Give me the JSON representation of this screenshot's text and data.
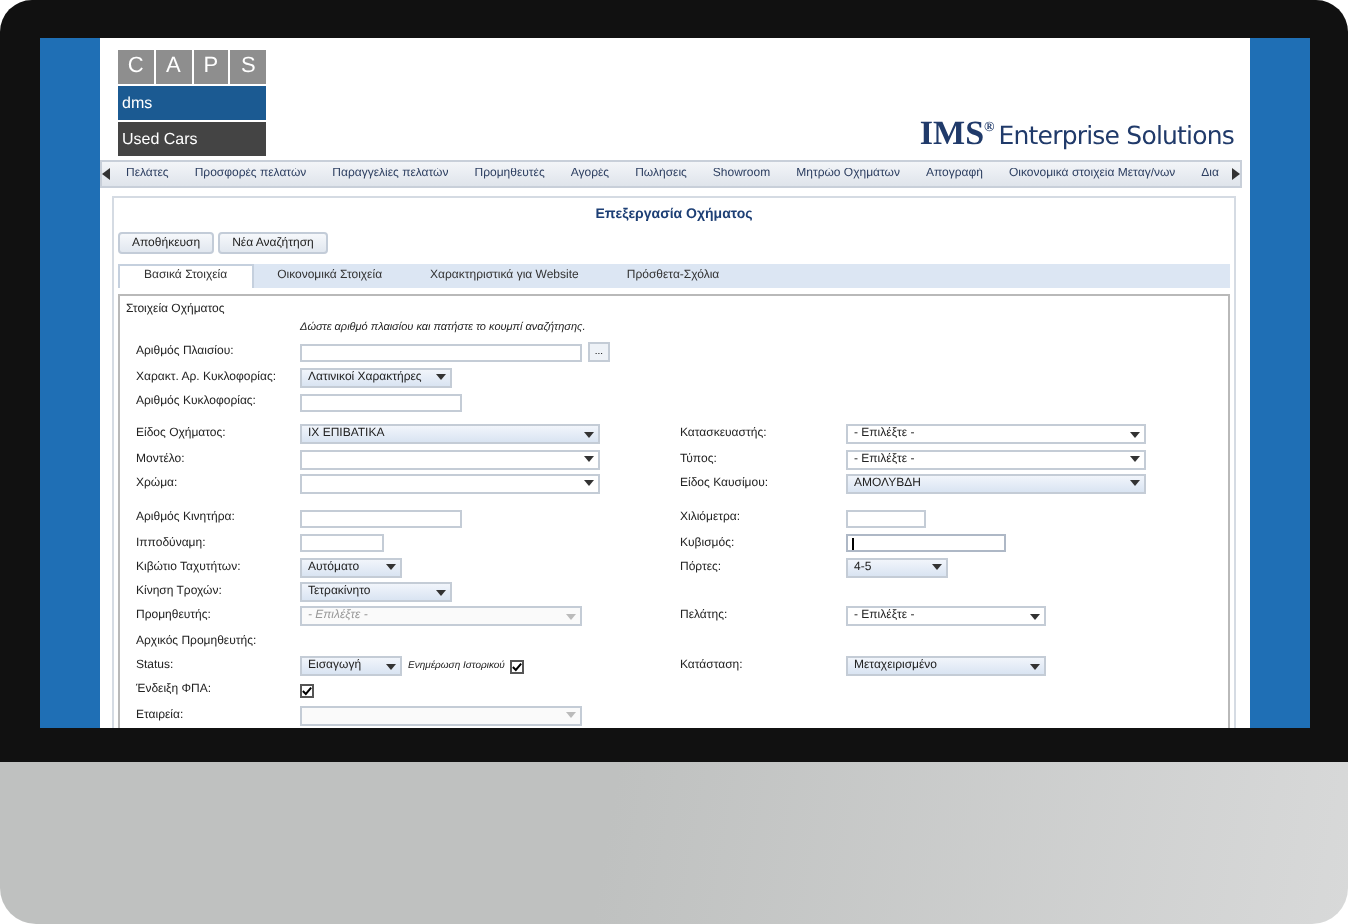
{
  "logo": {
    "letters": [
      "C",
      "A",
      "P",
      "S"
    ],
    "product": "dms",
    "module": "Used Cars"
  },
  "brand": {
    "name": "IMS$^{®}$",
    "tagline": "Enterprise Solutions"
  },
  "menu": {
    "items": [
      {
        "label": "Πελάτες"
      },
      {
        "label": "Προσφορές πελατών"
      },
      {
        "label": "Παραγγελίες πελατών"
      },
      {
        "label": "Προμηθευτές"
      },
      {
        "label": "Αγορές"
      },
      {
        "label": "Πωλήσεις"
      },
      {
        "label": "Showroom"
      },
      {
        "label": "Μητρώο Οχημάτων"
      },
      {
        "label": "Απογραφή"
      },
      {
        "label": "Οικονομικά στοιχεία Μεταγ/νων"
      },
      {
        "label": "Δια"
      }
    ]
  },
  "page": {
    "title": "Επεξεργασία Οχήματος",
    "buttons": [
      "Αποθήκευση",
      "Νέα Αναζήτηση"
    ]
  },
  "tabs": [
    {
      "label": "Βασικά Στοιχεία",
      "selected": true
    },
    {
      "label": "Οικονομικά Στοιχεία",
      "selected": false
    },
    {
      "label": "Χαρακτηριστικά για Website",
      "selected": false
    },
    {
      "label": "Πρόσθετα-Σχόλια",
      "selected": false
    }
  ],
  "fieldset": {
    "legend": "Στοιχεία Οχήματος",
    "rows": [
      {
        "hint": "Δώστε αριθμό πλαισίου και πατήστε το κουμπί αναζήτησης."
      },
      {
        "left": {
          "label": "Αριθμός Πλαισίου:",
          "kind": "text",
          "button": "..."
        }
      },
      {
        "left": {
          "label": "Χαρακτ. Αρ. Κυκλοφορίας:",
          "kind": "select",
          "value": "Λατινικοί Χαρακτήρες"
        }
      },
      {
        "left": {
          "label": "Αριθμός Κυκλοφορίας:",
          "kind": "text"
        }
      },
      {
        "left": {
          "label": "Είδος Οχήματος:",
          "kind": "select",
          "value": "ΙΧ ΕΠΙΒΑΤΙΚΑ"
        },
        "right": {
          "label": "Κατασκευαστής:",
          "kind": "select",
          "placeholder": "- Επιλέξτε -"
        }
      },
      {
        "left": {
          "label": "Μοντέλο:",
          "kind": "select"
        },
        "right": {
          "label": "Τύπος:",
          "kind": "select",
          "placeholder": "- Επιλέξτε -"
        }
      },
      {
        "left": {
          "label": "Χρώμα:",
          "kind": "select"
        },
        "right": {
          "label": "Είδος Καυσίμου:",
          "kind": "select",
          "value": "ΑΜΟΛΥΒΔΗ"
        }
      },
      {
        "left": {
          "label": "Αριθμός Κινητήρα:",
          "kind": "text"
        },
        "right": {
          "label": "Χιλιόμετρα:",
          "kind": "text"
        }
      },
      {
        "left": {
          "label": "Ιπποδύναμη:",
          "kind": "text"
        },
        "right": {
          "label": "Κυβισμός:",
          "kind": "text",
          "focused": true
        }
      },
      {
        "left": {
          "label": "Κιβώτιο Ταχυτήτων:",
          "kind": "select",
          "value": "Αυτόματο"
        },
        "right": {
          "label": "Πόρτες:",
          "kind": "select",
          "value": "4-5"
        }
      },
      {
        "left": {
          "label": "Κίνηση Τροχών:",
          "kind": "select",
          "value": "Τετρακίνητο"
        }
      },
      {
        "left": {
          "label": "Προμηθευτής:",
          "kind": "select",
          "placeholder": "- Επιλέξτε -",
          "disabled": true
        },
        "right": {
          "label": "Πελάτης:",
          "kind": "select",
          "placeholder": "- Επιλέξτε -"
        }
      },
      {
        "left": {
          "label": "Αρχικός Προμηθευτής:",
          "kind": "none"
        }
      },
      {
        "left": {
          "label": "Status:",
          "kind": "select",
          "value": "Εισαγωγή",
          "option": {
            "label": "Ενημέρωση Ιστορικού",
            "checked": true
          }
        },
        "right": {
          "label": "Κατάσταση:",
          "kind": "select",
          "value": "Μεταχειρισμένο"
        }
      },
      {
        "left": {
          "label": "Ένδειξη ΦΠΑ:",
          "kind": "checkbox",
          "checked": true
        }
      },
      {
        "left": {
          "label": "Εταιρεία:",
          "kind": "select",
          "disabled": true
        }
      }
    ]
  }
}
